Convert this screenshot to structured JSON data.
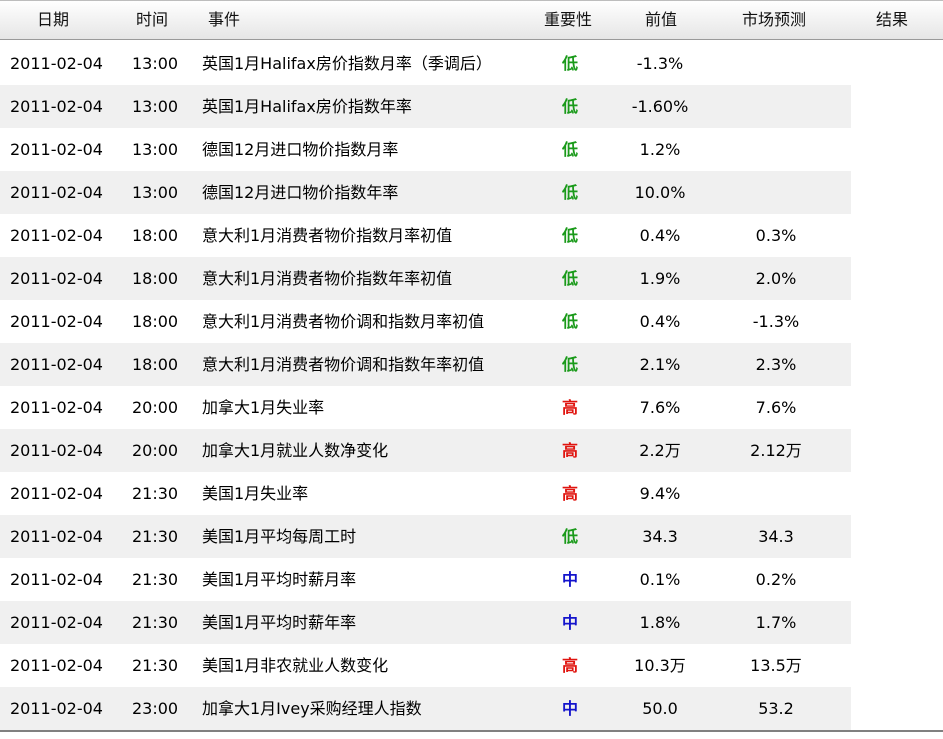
{
  "colors": {
    "low": "#1a9a1a",
    "high": "#e0140f",
    "medium": "#1414cc"
  },
  "headers": {
    "date": "日期",
    "time": "时间",
    "event": "事件",
    "importance": "重要性",
    "previous": "前值",
    "forecast": "市场预测",
    "result": "结果"
  },
  "rows": [
    {
      "date": "2011-02-04",
      "time": "13:00",
      "event": "英国1月Halifax房价指数月率（季调后）",
      "importance": "低",
      "level": "low",
      "previous": "-1.3%",
      "forecast": "",
      "result": ""
    },
    {
      "date": "2011-02-04",
      "time": "13:00",
      "event": "英国1月Halifax房价指数年率",
      "importance": "低",
      "level": "low",
      "previous": "-1.60%",
      "forecast": "",
      "result": ""
    },
    {
      "date": "2011-02-04",
      "time": "13:00",
      "event": "德国12月进口物价指数月率",
      "importance": "低",
      "level": "low",
      "previous": "1.2%",
      "forecast": "",
      "result": ""
    },
    {
      "date": "2011-02-04",
      "time": "13:00",
      "event": "德国12月进口物价指数年率",
      "importance": "低",
      "level": "low",
      "previous": "10.0%",
      "forecast": "",
      "result": ""
    },
    {
      "date": "2011-02-04",
      "time": "18:00",
      "event": "意大利1月消费者物价指数月率初值",
      "importance": "低",
      "level": "low",
      "previous": "0.4%",
      "forecast": "0.3%",
      "result": ""
    },
    {
      "date": "2011-02-04",
      "time": "18:00",
      "event": "意大利1月消费者物价指数年率初值",
      "importance": "低",
      "level": "low",
      "previous": "1.9%",
      "forecast": "2.0%",
      "result": ""
    },
    {
      "date": "2011-02-04",
      "time": "18:00",
      "event": "意大利1月消费者物价调和指数月率初值",
      "importance": "低",
      "level": "low",
      "previous": "0.4%",
      "forecast": "-1.3%",
      "result": ""
    },
    {
      "date": "2011-02-04",
      "time": "18:00",
      "event": "意大利1月消费者物价调和指数年率初值",
      "importance": "低",
      "level": "low",
      "previous": "2.1%",
      "forecast": "2.3%",
      "result": ""
    },
    {
      "date": "2011-02-04",
      "time": "20:00",
      "event": "加拿大1月失业率",
      "importance": "高",
      "level": "high",
      "previous": "7.6%",
      "forecast": "7.6%",
      "result": ""
    },
    {
      "date": "2011-02-04",
      "time": "20:00",
      "event": "加拿大1月就业人数净变化",
      "importance": "高",
      "level": "high",
      "previous": "2.2万",
      "forecast": "2.12万",
      "result": ""
    },
    {
      "date": "2011-02-04",
      "time": "21:30",
      "event": "美国1月失业率",
      "importance": "高",
      "level": "high",
      "previous": "9.4%",
      "forecast": "",
      "result": ""
    },
    {
      "date": "2011-02-04",
      "time": "21:30",
      "event": "美国1月平均每周工时",
      "importance": "低",
      "level": "low",
      "previous": "34.3",
      "forecast": "34.3",
      "result": ""
    },
    {
      "date": "2011-02-04",
      "time": "21:30",
      "event": "美国1月平均时薪月率",
      "importance": "中",
      "level": "medium",
      "previous": "0.1%",
      "forecast": "0.2%",
      "result": ""
    },
    {
      "date": "2011-02-04",
      "time": "21:30",
      "event": "美国1月平均时薪年率",
      "importance": "中",
      "level": "medium",
      "previous": "1.8%",
      "forecast": "1.7%",
      "result": ""
    },
    {
      "date": "2011-02-04",
      "time": "21:30",
      "event": "美国1月非农就业人数变化",
      "importance": "高",
      "level": "high",
      "previous": "10.3万",
      "forecast": "13.5万",
      "result": ""
    },
    {
      "date": "2011-02-04",
      "time": "23:00",
      "event": "加拿大1月Ivey采购经理人指数",
      "importance": "中",
      "level": "medium",
      "previous": "50.0",
      "forecast": "53.2",
      "result": ""
    }
  ]
}
